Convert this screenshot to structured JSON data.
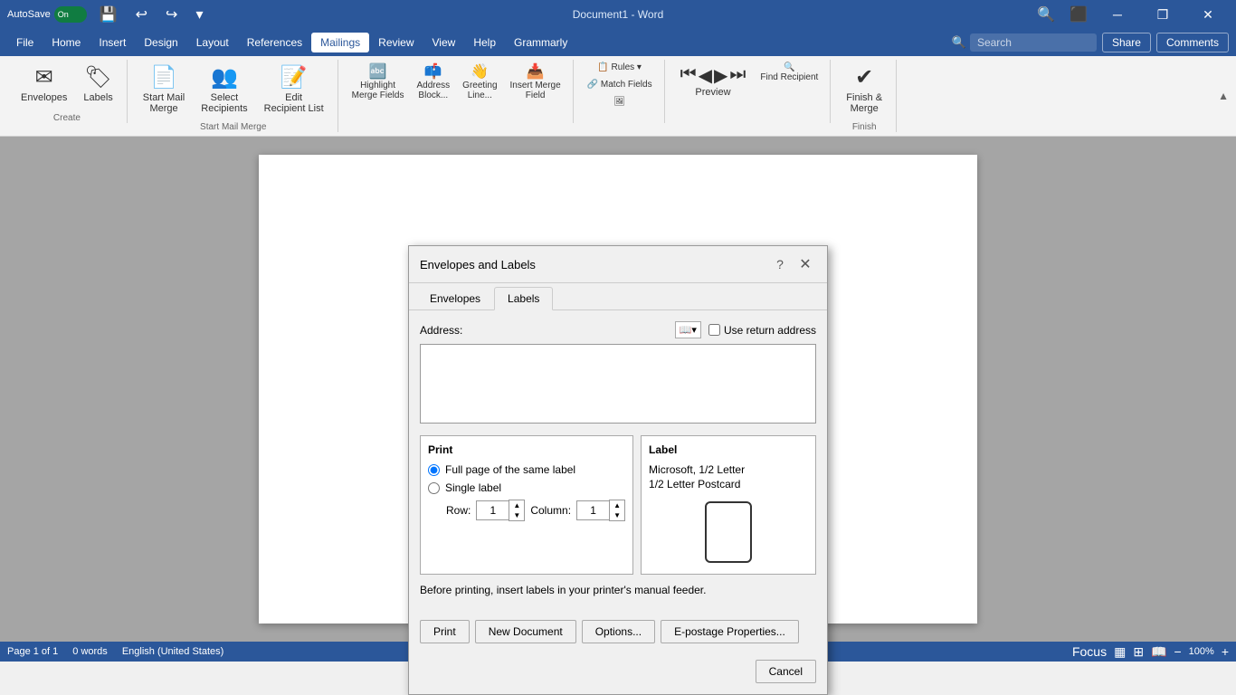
{
  "titleBar": {
    "autosave": "AutoSave",
    "autosaveState": "On",
    "title": "Document1 - Word",
    "minimize": "─",
    "restore": "❐",
    "close": "✕"
  },
  "menuBar": {
    "items": [
      {
        "label": "File",
        "active": false
      },
      {
        "label": "Home",
        "active": false
      },
      {
        "label": "Insert",
        "active": false
      },
      {
        "label": "Design",
        "active": false
      },
      {
        "label": "Layout",
        "active": false
      },
      {
        "label": "References",
        "active": false
      },
      {
        "label": "Mailings",
        "active": true
      },
      {
        "label": "Review",
        "active": false
      },
      {
        "label": "View",
        "active": false
      },
      {
        "label": "Help",
        "active": false
      },
      {
        "label": "Grammarly",
        "active": false
      }
    ],
    "search": "Search",
    "share": "Share",
    "comments": "Comments"
  },
  "ribbon": {
    "groups": [
      {
        "label": "Create",
        "buttons": [
          {
            "icon": "✉",
            "label": "Envelopes"
          },
          {
            "icon": "🏷",
            "label": "Labels"
          }
        ]
      },
      {
        "label": "Start Mail Merge",
        "buttons": [
          {
            "icon": "📄",
            "label": "Start Mail\nMerge"
          },
          {
            "icon": "👥",
            "label": "Select\nRecipients"
          },
          {
            "icon": "📝",
            "label": "Edit\nRecipient List"
          }
        ]
      },
      {
        "label": "",
        "buttons": [
          {
            "icon": "🔤",
            "label": "Highlight\nMerge Fields"
          },
          {
            "icon": "📫",
            "label": "Address\nBlock..."
          },
          {
            "icon": "👋",
            "label": "Greeting\nLine..."
          },
          {
            "icon": "📥",
            "label": "Insert Merge\nField"
          }
        ]
      },
      {
        "label": "",
        "buttons": [
          {
            "icon": "📋",
            "label": "Rules"
          },
          {
            "icon": "🔗",
            "label": "Match Fields"
          },
          {
            "icon": "🖼",
            "label": ""
          }
        ]
      },
      {
        "label": "",
        "buttons": [
          {
            "icon": "⏮",
            "label": ""
          },
          {
            "icon": "◀",
            "label": ""
          },
          {
            "icon": "▶",
            "label": ""
          },
          {
            "icon": "⏭",
            "label": ""
          },
          {
            "icon": "ABC",
            "label": "Preview"
          },
          {
            "icon": "🔍",
            "label": "Find Recipient"
          }
        ]
      },
      {
        "label": "Finish",
        "buttons": [
          {
            "icon": "✔",
            "label": "Finish &\nMerge"
          }
        ]
      }
    ]
  },
  "dialog": {
    "title": "Envelopes and Labels",
    "tabs": [
      {
        "label": "Envelopes",
        "active": false
      },
      {
        "label": "Labels",
        "active": true
      }
    ],
    "address": {
      "label": "Address:",
      "value": "",
      "placeholder": ""
    },
    "useReturnAddress": "Use return address",
    "print": {
      "title": "Print",
      "fullPageOption": "Full page of the same label",
      "singleLabelOption": "Single label",
      "rowLabel": "Row:",
      "rowValue": "1",
      "columnLabel": "Column:",
      "columnValue": "1"
    },
    "label": {
      "title": "Label",
      "name": "Microsoft, 1/2 Letter",
      "subname": "1/2 Letter Postcard"
    },
    "infoText": "Before printing, insert labels in your printer's manual feeder.",
    "buttons": {
      "print": "Print",
      "newDocument": "New Document",
      "options": "Options...",
      "ePostage": "E-postage Properties..."
    },
    "cancelButton": "Cancel"
  },
  "statusBar": {
    "pageInfo": "Page 1 of 1",
    "wordCount": "0 words",
    "language": "English (United States)",
    "focus": "Focus",
    "zoom": "100%"
  }
}
